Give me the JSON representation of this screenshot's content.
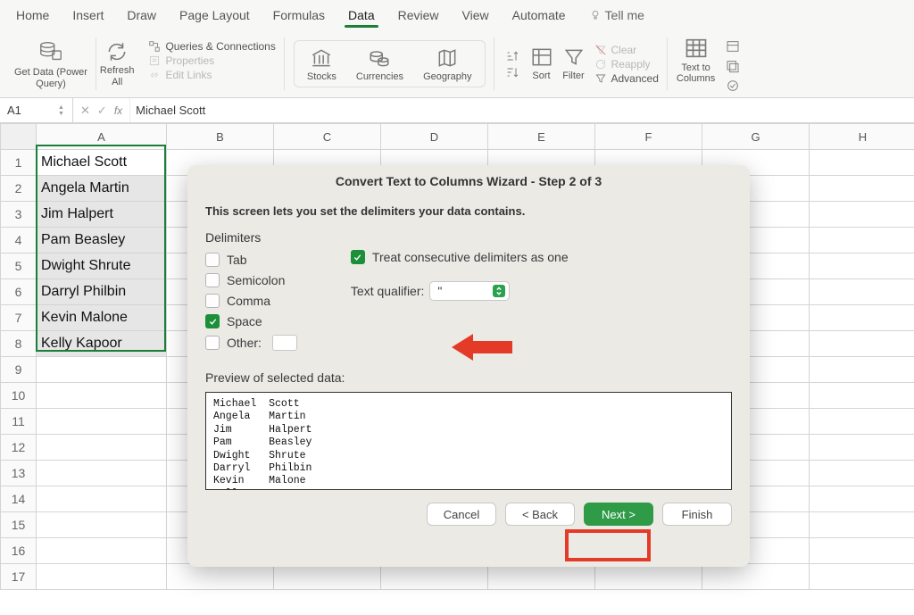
{
  "tabs": {
    "home": "Home",
    "insert": "Insert",
    "draw": "Draw",
    "page_layout": "Page Layout",
    "formulas": "Formulas",
    "data": "Data",
    "review": "Review",
    "view": "View",
    "automate": "Automate",
    "tellme": "Tell me"
  },
  "ribbon": {
    "get_data": "Get Data (Power\nQuery)",
    "refresh_all": "Refresh\nAll",
    "qc": "Queries & Connections",
    "props": "Properties",
    "editlinks": "Edit Links",
    "stocks": "Stocks",
    "currencies": "Currencies",
    "geography": "Geography",
    "sort": "Sort",
    "filter": "Filter",
    "clear": "Clear",
    "reapply": "Reapply",
    "advanced": "Advanced",
    "text_to_columns": "Text to\nColumns"
  },
  "formula_bar": {
    "namebox": "A1",
    "value": "Michael Scott"
  },
  "columns": [
    "A",
    "B",
    "C",
    "D",
    "E",
    "F",
    "G",
    "H"
  ],
  "row_numbers": [
    1,
    2,
    3,
    4,
    5,
    6,
    7,
    8,
    9,
    10,
    11,
    12,
    13,
    14,
    15,
    16,
    17
  ],
  "cells_a": [
    "Michael Scott",
    "Angela Martin",
    "Jim Halpert",
    "Pam Beasley",
    "Dwight Shrute",
    "Darryl Philbin",
    "Kevin Malone",
    "Kelly Kapoor"
  ],
  "dialog": {
    "title": "Convert Text to Columns Wizard - Step 2 of 3",
    "desc": "This screen lets you set the delimiters your data contains.",
    "delimiters_label": "Delimiters",
    "tab": "Tab",
    "semicolon": "Semicolon",
    "comma": "Comma",
    "space": "Space",
    "other": "Other:",
    "treat": "Treat consecutive delimiters as one",
    "qualifier_label": "Text qualifier:",
    "qualifier_value": "\"",
    "preview_label": "Preview of selected data:",
    "preview_text": "Michael  Scott\nAngela   Martin\nJim      Halpert\nPam      Beasley\nDwight   Shrute\nDarryl   Philbin\nKevin    Malone\nKelly    Kapoor",
    "cancel": "Cancel",
    "back": "< Back",
    "next": "Next >",
    "finish": "Finish"
  }
}
